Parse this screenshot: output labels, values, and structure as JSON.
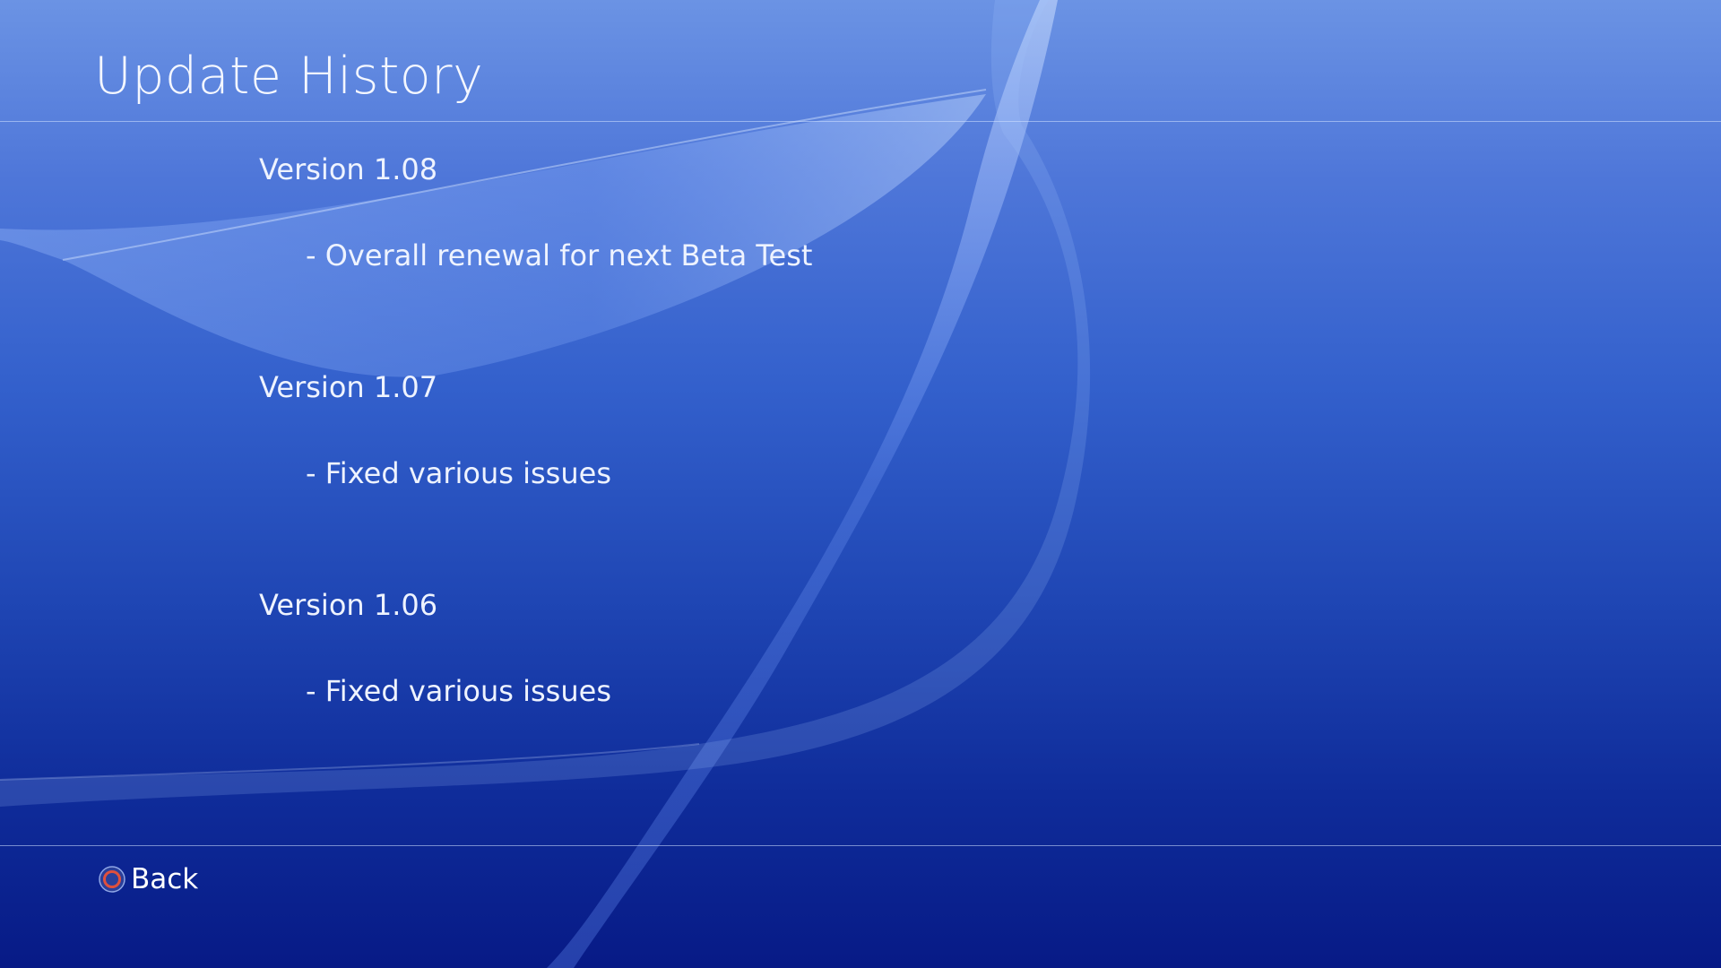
{
  "header": {
    "title": "Update History"
  },
  "history": [
    {
      "version": "Version 1.08",
      "note": "- Overall renewal for next Beta Test"
    },
    {
      "version": "Version 1.07",
      "note": "- Fixed various issues"
    },
    {
      "version": "Version 1.06",
      "note": "- Fixed various issues"
    }
  ],
  "footer": {
    "back_icon": "circle-button-icon",
    "back_label": "Back"
  },
  "colors": {
    "background_top": "#6b93e4",
    "background_bottom": "#071a86",
    "circle_button": "#e0503c"
  }
}
